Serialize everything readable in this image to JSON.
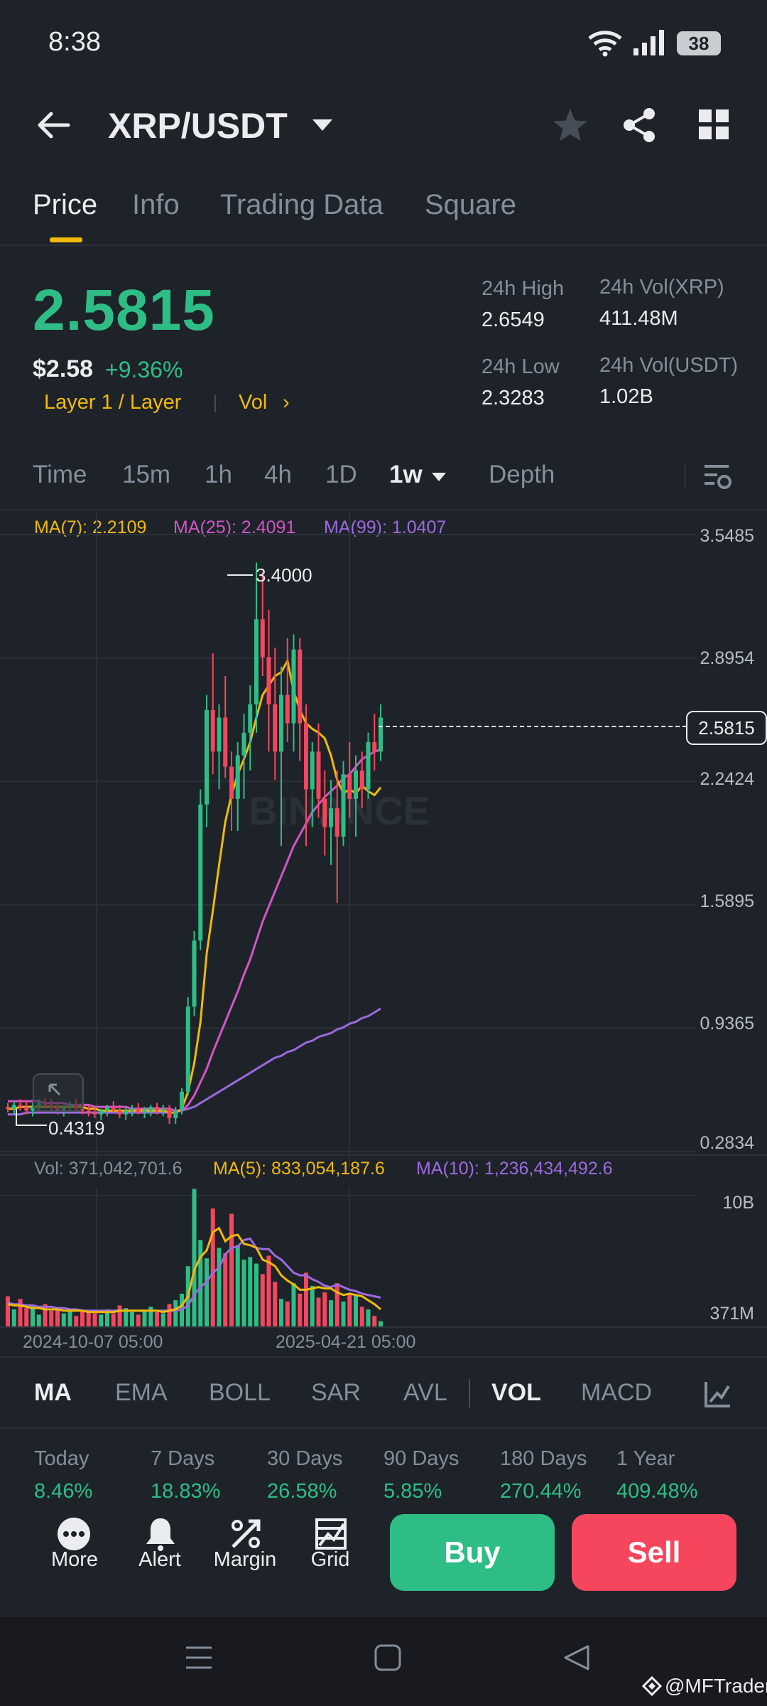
{
  "status": {
    "time": "8:38",
    "battery": "38"
  },
  "header": {
    "pair": "XRP/USDT"
  },
  "tabs": [
    "Price",
    "Info",
    "Trading Data",
    "Square"
  ],
  "ticker": {
    "last_price": "2.5815",
    "usd_price": "$2.58",
    "change_pct": "+9.36%",
    "tag_category": "Layer 1 / Layer",
    "tag_vol": "Vol",
    "high_label": "24h High",
    "high_value": "2.6549",
    "low_label": "24h Low",
    "low_value": "2.3283",
    "vol_xrp_label": "24h Vol(XRP)",
    "vol_xrp_value": "411.48M",
    "vol_usdt_label": "24h Vol(USDT)",
    "vol_usdt_value": "1.02B"
  },
  "intervals": [
    "Time",
    "15m",
    "1h",
    "4h",
    "1D",
    "1w",
    "Depth"
  ],
  "chart_labels": {
    "ma7": "MA(7): 2.2109",
    "ma25": "MA(25): 2.4091",
    "ma99": "MA(99): 1.0407",
    "y_ticks": [
      "3.5485",
      "2.8954",
      "2.2424",
      "1.5895",
      "0.9365",
      "0.2834"
    ],
    "current_price": "2.5815",
    "max_label": "3.4000",
    "min_label": "0.4319",
    "watermark": "BINANCE",
    "vol_line": "Vol: 371,042,701.6",
    "ma5_vol": "MA(5): 833,054,187.6",
    "ma10_vol": "MA(10): 1,236,434,492.6",
    "vol_ticks": [
      "10B",
      "371M"
    ],
    "x_ticks": [
      "2024-10-07 05:00",
      "2025-04-21 05:00"
    ]
  },
  "chart_data": {
    "type": "candlestick",
    "ylim": [
      0.2834,
      3.5485
    ],
    "x_ticks": [
      "2024-10-07 05:00",
      "2025-04-21 05:00"
    ],
    "colors": {
      "up": "#2ebd85",
      "down": "#f6465d",
      "ma7": "#f0b90b",
      "ma25": "#d156c6",
      "ma99": "#9c6ade"
    },
    "candles": [
      [
        0.52,
        0.54,
        0.49,
        0.51
      ],
      [
        0.51,
        0.55,
        0.48,
        0.53
      ],
      [
        0.53,
        0.56,
        0.5,
        0.52
      ],
      [
        0.52,
        0.55,
        0.48,
        0.5
      ],
      [
        0.5,
        0.54,
        0.47,
        0.52
      ],
      [
        0.52,
        0.56,
        0.5,
        0.54
      ],
      [
        0.54,
        0.57,
        0.51,
        0.53
      ],
      [
        0.53,
        0.56,
        0.5,
        0.52
      ],
      [
        0.52,
        0.54,
        0.48,
        0.5
      ],
      [
        0.5,
        0.53,
        0.47,
        0.52
      ],
      [
        0.52,
        0.55,
        0.49,
        0.53
      ],
      [
        0.53,
        0.56,
        0.5,
        0.51
      ],
      [
        0.51,
        0.54,
        0.48,
        0.5
      ],
      [
        0.5,
        0.53,
        0.47,
        0.49
      ],
      [
        0.49,
        0.52,
        0.46,
        0.48
      ],
      [
        0.48,
        0.51,
        0.45,
        0.5
      ],
      [
        0.5,
        0.53,
        0.47,
        0.52
      ],
      [
        0.52,
        0.55,
        0.49,
        0.5
      ],
      [
        0.5,
        0.53,
        0.46,
        0.48
      ],
      [
        0.48,
        0.52,
        0.45,
        0.5
      ],
      [
        0.5,
        0.53,
        0.47,
        0.51
      ],
      [
        0.51,
        0.54,
        0.48,
        0.49
      ],
      [
        0.49,
        0.52,
        0.46,
        0.5
      ],
      [
        0.5,
        0.53,
        0.47,
        0.52
      ],
      [
        0.52,
        0.54,
        0.48,
        0.5
      ],
      [
        0.5,
        0.53,
        0.47,
        0.51
      ],
      [
        0.51,
        0.53,
        0.43,
        0.46
      ],
      [
        0.46,
        0.52,
        0.43,
        0.5
      ],
      [
        0.5,
        0.62,
        0.48,
        0.6
      ],
      [
        0.6,
        1.1,
        0.58,
        1.05
      ],
      [
        1.05,
        1.45,
        1.0,
        1.4
      ],
      [
        1.4,
        2.2,
        1.35,
        2.12
      ],
      [
        2.12,
        2.7,
        2.0,
        2.62
      ],
      [
        2.62,
        2.92,
        2.28,
        2.4
      ],
      [
        2.4,
        2.65,
        2.2,
        2.58
      ],
      [
        2.58,
        2.8,
        2.26,
        2.32
      ],
      [
        2.32,
        2.4,
        1.98,
        2.15
      ],
      [
        2.15,
        2.45,
        1.98,
        2.38
      ],
      [
        2.38,
        2.6,
        2.15,
        2.5
      ],
      [
        2.5,
        2.75,
        2.3,
        2.65
      ],
      [
        2.65,
        3.4,
        2.5,
        3.1
      ],
      [
        3.1,
        3.35,
        2.8,
        2.9
      ],
      [
        2.9,
        3.15,
        2.4,
        2.65
      ],
      [
        2.65,
        2.95,
        2.25,
        2.4
      ],
      [
        2.4,
        2.85,
        1.9,
        2.7
      ],
      [
        2.7,
        3.0,
        2.45,
        2.55
      ],
      [
        2.55,
        3.02,
        2.4,
        2.94
      ],
      [
        2.94,
        3.0,
        2.35,
        2.55
      ],
      [
        2.55,
        2.65,
        1.9,
        2.2
      ],
      [
        2.2,
        2.45,
        2.0,
        2.4
      ],
      [
        2.4,
        2.55,
        2.05,
        2.15
      ],
      [
        2.15,
        2.3,
        1.85,
        2.0
      ],
      [
        2.0,
        2.25,
        1.8,
        2.1
      ],
      [
        2.1,
        2.3,
        1.6,
        1.95
      ],
      [
        1.95,
        2.35,
        1.9,
        2.28
      ],
      [
        2.28,
        2.45,
        2.05,
        2.15
      ],
      [
        2.15,
        2.38,
        1.95,
        2.3
      ],
      [
        2.3,
        2.4,
        2.1,
        2.2
      ],
      [
        2.2,
        2.5,
        2.15,
        2.45
      ],
      [
        2.45,
        2.6,
        2.3,
        2.4
      ],
      [
        2.4,
        2.65,
        2.35,
        2.58
      ]
    ],
    "ma7": [
      0.51,
      0.51,
      0.52,
      0.52,
      0.52,
      0.52,
      0.52,
      0.52,
      0.52,
      0.52,
      0.52,
      0.52,
      0.52,
      0.51,
      0.51,
      0.5,
      0.5,
      0.5,
      0.5,
      0.5,
      0.5,
      0.5,
      0.5,
      0.5,
      0.5,
      0.5,
      0.49,
      0.49,
      0.51,
      0.6,
      0.75,
      0.97,
      1.33,
      1.56,
      1.8,
      2.03,
      2.17,
      2.28,
      2.36,
      2.45,
      2.58,
      2.7,
      2.75,
      2.8,
      2.82,
      2.88,
      2.72,
      2.62,
      2.55,
      2.52,
      2.5,
      2.47,
      2.38,
      2.25,
      2.18,
      2.2,
      2.18,
      2.22,
      2.19,
      2.17,
      2.21
    ],
    "ma25": [
      0.55,
      0.55,
      0.55,
      0.55,
      0.55,
      0.55,
      0.54,
      0.54,
      0.54,
      0.54,
      0.53,
      0.53,
      0.53,
      0.53,
      0.52,
      0.52,
      0.52,
      0.52,
      0.52,
      0.52,
      0.51,
      0.51,
      0.51,
      0.51,
      0.51,
      0.51,
      0.51,
      0.5,
      0.5,
      0.53,
      0.58,
      0.65,
      0.72,
      0.81,
      0.89,
      0.97,
      1.05,
      1.13,
      1.22,
      1.3,
      1.4,
      1.5,
      1.58,
      1.66,
      1.74,
      1.82,
      1.9,
      1.96,
      2.02,
      2.08,
      2.12,
      2.16,
      2.19,
      2.22,
      2.26,
      2.28,
      2.32,
      2.36,
      2.38,
      2.4,
      2.41
    ],
    "ma99": [
      0.48,
      0.48,
      0.48,
      0.49,
      0.49,
      0.49,
      0.49,
      0.49,
      0.49,
      0.49,
      0.49,
      0.49,
      0.49,
      0.49,
      0.49,
      0.49,
      0.49,
      0.49,
      0.49,
      0.49,
      0.49,
      0.49,
      0.49,
      0.49,
      0.49,
      0.49,
      0.49,
      0.49,
      0.5,
      0.51,
      0.52,
      0.54,
      0.56,
      0.58,
      0.6,
      0.62,
      0.64,
      0.66,
      0.68,
      0.7,
      0.72,
      0.74,
      0.76,
      0.78,
      0.79,
      0.81,
      0.82,
      0.84,
      0.86,
      0.87,
      0.89,
      0.9,
      0.91,
      0.93,
      0.94,
      0.96,
      0.97,
      0.99,
      1.0,
      1.02,
      1.04
    ],
    "volume_ylim": [
      0,
      10000000000
    ],
    "volumes": [
      2.3,
      1.3,
      2.1,
      1.4,
      1.6,
      0.9,
      1.7,
      1.2,
      1.4,
      1.0,
      1.3,
      0.8,
      1.2,
      1.1,
      1.0,
      0.9,
      1.3,
      1.0,
      1.6,
      1.4,
      1.1,
      0.9,
      1.2,
      1.5,
      1.1,
      1.0,
      1.7,
      2.0,
      2.5,
      4.6,
      10.5,
      6.6,
      5.2,
      9.0,
      6.0,
      5.6,
      8.6,
      6.2,
      5.1,
      5.3,
      4.8,
      4.0,
      5.4,
      3.4,
      2.1,
      1.9,
      3.3,
      2.5,
      4.1,
      3.1,
      2.2,
      2.6,
      2.0,
      3.3,
      1.9,
      2.5,
      2.4,
      1.5,
      1.3,
      0.8,
      0.4
    ],
    "volume_ma5": [
      1.7,
      1.6,
      1.6,
      1.5,
      1.4,
      1.4,
      1.3,
      1.3,
      1.3,
      1.2,
      1.2,
      1.2,
      1.2,
      1.1,
      1.1,
      1.1,
      1.1,
      1.1,
      1.2,
      1.2,
      1.2,
      1.2,
      1.2,
      1.2,
      1.2,
      1.1,
      1.2,
      1.3,
      1.6,
      2.3,
      4.3,
      5.3,
      5.8,
      7.2,
      7.5,
      6.5,
      6.9,
      7.0,
      6.3,
      6.2,
      6.0,
      5.1,
      4.9,
      4.6,
      3.9,
      3.5,
      3.2,
      2.8,
      2.8,
      2.9,
      3.0,
      2.9,
      2.9,
      2.6,
      2.4,
      2.5,
      2.4,
      2.3,
      2.0,
      1.7,
      1.3
    ],
    "volume_ma10": [
      1.8,
      1.7,
      1.7,
      1.6,
      1.6,
      1.5,
      1.5,
      1.5,
      1.4,
      1.4,
      1.3,
      1.3,
      1.2,
      1.2,
      1.2,
      1.2,
      1.2,
      1.2,
      1.2,
      1.2,
      1.2,
      1.2,
      1.2,
      1.2,
      1.2,
      1.2,
      1.2,
      1.2,
      1.3,
      1.6,
      2.4,
      3.0,
      3.4,
      4.1,
      4.5,
      5.5,
      6.0,
      6.1,
      6.6,
      6.7,
      6.0,
      5.9,
      5.9,
      5.4,
      5.1,
      4.6,
      4.1,
      3.9,
      3.9,
      3.6,
      3.4,
      3.1,
      3.0,
      3.2,
      3.0,
      2.8,
      2.7,
      2.5,
      2.4,
      2.3,
      2.2
    ]
  },
  "indicators": [
    "MA",
    "EMA",
    "BOLL",
    "SAR",
    "AVL",
    "VOL",
    "MACD"
  ],
  "performance": {
    "labels": [
      "Today",
      "7 Days",
      "30 Days",
      "90 Days",
      "180 Days",
      "1 Year"
    ],
    "values": [
      "8.46%",
      "18.83%",
      "26.58%",
      "5.85%",
      "270.44%",
      "409.48%"
    ]
  },
  "bottom": {
    "more": "More",
    "alert": "Alert",
    "margin": "Margin",
    "grid": "Grid",
    "buy": "Buy",
    "sell": "Sell"
  },
  "watermark_credit": "@MFTrader"
}
